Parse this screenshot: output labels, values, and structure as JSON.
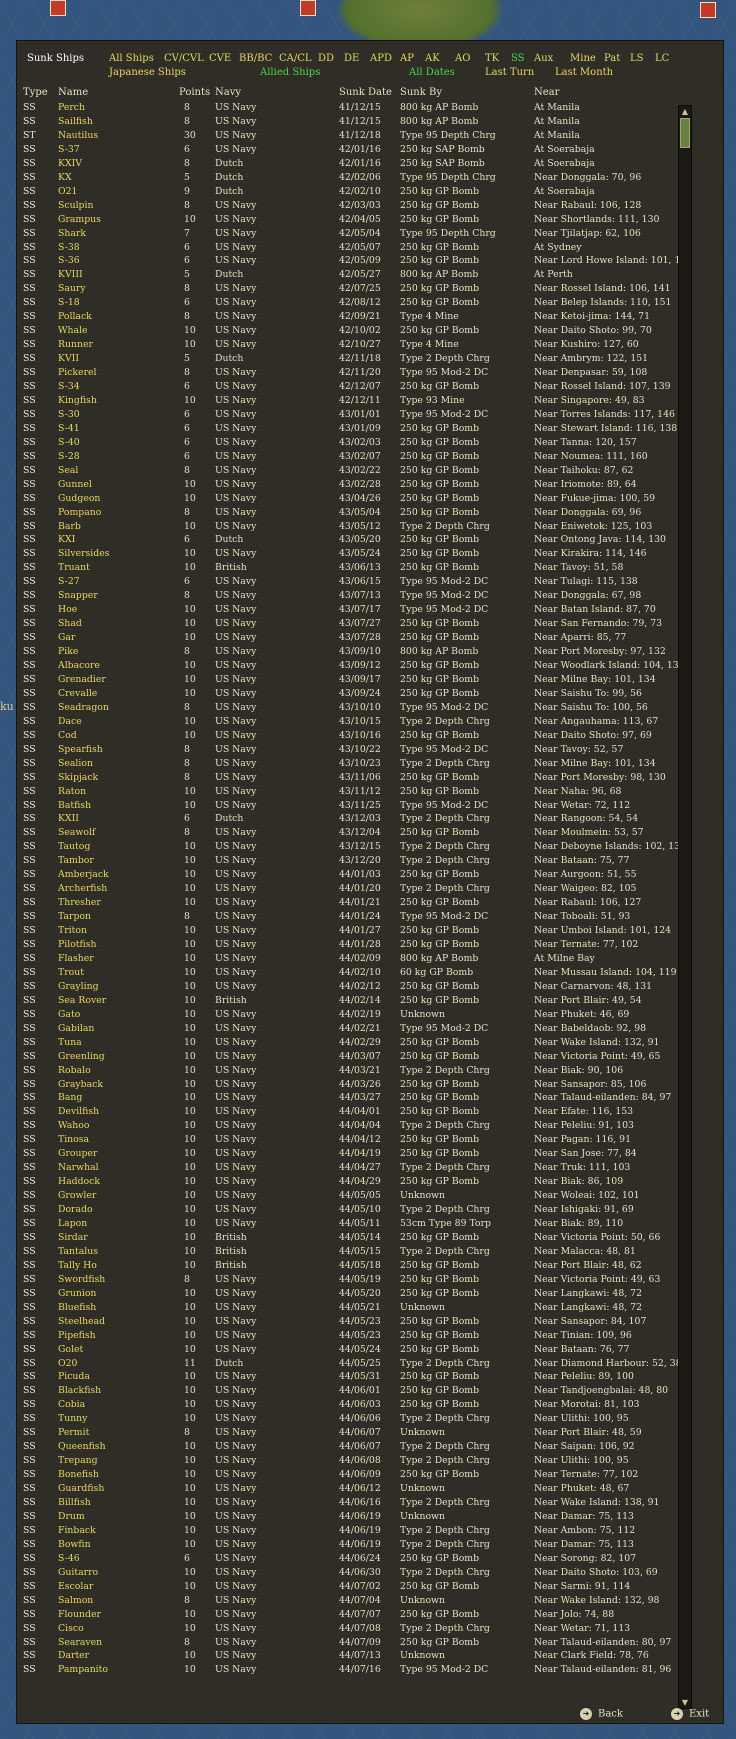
{
  "window_title": "Sunk Ships",
  "filters": {
    "all_ships": "All Ships",
    "cv_cvl": "CV/CVL",
    "cve": "CVE",
    "bb_bc": "BB/BC",
    "ca_cl": "CA/CL",
    "dd": "DD",
    "de": "DE",
    "apd": "APD",
    "ap": "AP",
    "ak": "AK",
    "ao": "AO",
    "tk": "TK",
    "ss": "SS",
    "aux": "Aux",
    "mine": "Mine",
    "pat": "Pat",
    "ls": "LS",
    "lc": "LC",
    "japanese": "Japanese Ships",
    "allied": "Allied Ships",
    "all_dates": "All Dates",
    "last_turn": "Last Turn",
    "last_month": "Last Month"
  },
  "columns": {
    "type": "Type",
    "name": "Name",
    "points": "Points",
    "navy": "Navy",
    "sunk_date": "Sunk Date",
    "sunk_by": "Sunk By",
    "near": "Near"
  },
  "rows": [
    [
      "SS",
      "Perch",
      "8",
      "US Navy",
      "41/12/15",
      "800 kg AP Bomb",
      "At Manila"
    ],
    [
      "SS",
      "Sailfish",
      "8",
      "US Navy",
      "41/12/15",
      "800 kg AP Bomb",
      "At Manila"
    ],
    [
      "ST",
      "Nautilus",
      "30",
      "US Navy",
      "41/12/18",
      "Type 95 Depth Chrg",
      "At Manila"
    ],
    [
      "SS",
      "S-37",
      "6",
      "US Navy",
      "42/01/16",
      "250 kg SAP Bomb",
      "At Soerabaja"
    ],
    [
      "SS",
      "KXIV",
      "8",
      "Dutch",
      "42/01/16",
      "250 kg SAP Bomb",
      "At Soerabaja"
    ],
    [
      "SS",
      "KX",
      "5",
      "Dutch",
      "42/02/06",
      "Type 95 Depth Chrg",
      "Near Donggala: 70, 96"
    ],
    [
      "SS",
      "O21",
      "9",
      "Dutch",
      "42/02/10",
      "250 kg GP Bomb",
      "At Soerabaja"
    ],
    [
      "SS",
      "Sculpin",
      "8",
      "US Navy",
      "42/03/03",
      "250 kg GP Bomb",
      "Near Rabaul: 106, 128"
    ],
    [
      "SS",
      "Grampus",
      "10",
      "US Navy",
      "42/04/05",
      "250 kg GP Bomb",
      "Near Shortlands: 111, 130"
    ],
    [
      "SS",
      "Shark",
      "7",
      "US Navy",
      "42/05/04",
      "Type 95 Depth Chrg",
      "Near Tjilatjap: 62, 106"
    ],
    [
      "SS",
      "S-38",
      "6",
      "US Navy",
      "42/05/07",
      "250 kg GP Bomb",
      "At Sydney"
    ],
    [
      "SS",
      "S-36",
      "6",
      "US Navy",
      "42/05/09",
      "250 kg GP Bomb",
      "Near Lord Howe Island: 101, 167"
    ],
    [
      "SS",
      "KVIII",
      "5",
      "Dutch",
      "42/05/27",
      "800 kg AP Bomb",
      "At Perth"
    ],
    [
      "SS",
      "Saury",
      "8",
      "US Navy",
      "42/07/25",
      "250 kg GP Bomb",
      "Near Rossel Island: 106, 141"
    ],
    [
      "SS",
      "S-18",
      "6",
      "US Navy",
      "42/08/12",
      "250 kg GP Bomb",
      "Near Belep Islands: 110, 151"
    ],
    [
      "SS",
      "Pollack",
      "8",
      "US Navy",
      "42/09/21",
      "Type 4 Mine",
      "Near Ketoi-jima: 144, 71"
    ],
    [
      "SS",
      "Whale",
      "10",
      "US Navy",
      "42/10/02",
      "250 kg GP Bomb",
      "Near Daito Shoto: 99, 70"
    ],
    [
      "SS",
      "Runner",
      "10",
      "US Navy",
      "42/10/27",
      "Type 4 Mine",
      "Near Kushiro: 127, 60"
    ],
    [
      "SS",
      "KVII",
      "5",
      "Dutch",
      "42/11/18",
      "Type 2 Depth Chrg",
      "Near Ambrym: 122, 151"
    ],
    [
      "SS",
      "Pickerel",
      "8",
      "US Navy",
      "42/11/20",
      "Type 95 Mod-2 DC",
      "Near Denpasar: 59, 108"
    ],
    [
      "SS",
      "S-34",
      "6",
      "US Navy",
      "42/12/07",
      "250 kg GP Bomb",
      "Near Rossel Island: 107, 139"
    ],
    [
      "SS",
      "Kingfish",
      "10",
      "US Navy",
      "42/12/11",
      "Type 93 Mine",
      "Near Singapore: 49, 83"
    ],
    [
      "SS",
      "S-30",
      "6",
      "US Navy",
      "43/01/01",
      "Type 95 Mod-2 DC",
      "Near Torres Islands: 117, 146"
    ],
    [
      "SS",
      "S-41",
      "6",
      "US Navy",
      "43/01/09",
      "250 kg GP Bomb",
      "Near Stewart Island: 116, 138"
    ],
    [
      "SS",
      "S-40",
      "6",
      "US Navy",
      "43/02/03",
      "250 kg GP Bomb",
      "Near Tanna: 120, 157"
    ],
    [
      "SS",
      "S-28",
      "6",
      "US Navy",
      "43/02/07",
      "250 kg GP Bomb",
      "Near Noumea: 111, 160"
    ],
    [
      "SS",
      "Seal",
      "8",
      "US Navy",
      "43/02/22",
      "250 kg GP Bomb",
      "Near Taihoku: 87, 62"
    ],
    [
      "SS",
      "Gunnel",
      "10",
      "US Navy",
      "43/02/28",
      "250 kg GP Bomb",
      "Near Iriomote: 89, 64"
    ],
    [
      "SS",
      "Gudgeon",
      "10",
      "US Navy",
      "43/04/26",
      "250 kg GP Bomb",
      "Near Fukue-jima: 100, 59"
    ],
    [
      "SS",
      "Pompano",
      "8",
      "US Navy",
      "43/05/04",
      "250 kg GP Bomb",
      "Near Donggala: 69, 96"
    ],
    [
      "SS",
      "Barb",
      "10",
      "US Navy",
      "43/05/12",
      "Type 2 Depth Chrg",
      "Near Eniwetok: 125, 103"
    ],
    [
      "SS",
      "KXI",
      "6",
      "Dutch",
      "43/05/20",
      "250 kg GP Bomb",
      "Near Ontong Java: 114, 130"
    ],
    [
      "SS",
      "Silversides",
      "10",
      "US Navy",
      "43/05/24",
      "250 kg GP Bomb",
      "Near Kirakira: 114, 146"
    ],
    [
      "SS",
      "Truant",
      "10",
      "British",
      "43/06/13",
      "250 kg GP Bomb",
      "Near Tavoy: 51, 58"
    ],
    [
      "SS",
      "S-27",
      "6",
      "US Navy",
      "43/06/15",
      "Type 95 Mod-2 DC",
      "Near Tulagi: 115, 138"
    ],
    [
      "SS",
      "Snapper",
      "8",
      "US Navy",
      "43/07/13",
      "Type 95 Mod-2 DC",
      "Near Donggala: 67, 98"
    ],
    [
      "SS",
      "Hoe",
      "10",
      "US Navy",
      "43/07/17",
      "Type 95 Mod-2 DC",
      "Near Batan Island: 87, 70"
    ],
    [
      "SS",
      "Shad",
      "10",
      "US Navy",
      "43/07/27",
      "250 kg GP Bomb",
      "Near San Fernando: 79, 73"
    ],
    [
      "SS",
      "Gar",
      "10",
      "US Navy",
      "43/07/28",
      "250 kg GP Bomb",
      "Near Aparri: 85, 77"
    ],
    [
      "SS",
      "Pike",
      "8",
      "US Navy",
      "43/09/10",
      "800 kg AP Bomb",
      "Near Port Moresby: 97, 132"
    ],
    [
      "SS",
      "Albacore",
      "10",
      "US Navy",
      "43/09/12",
      "250 kg GP Bomb",
      "Near Woodlark Island: 104, 133"
    ],
    [
      "SS",
      "Grenadier",
      "10",
      "US Navy",
      "43/09/17",
      "250 kg GP Bomb",
      "Near Milne Bay: 101, 134"
    ],
    [
      "SS",
      "Crevalle",
      "10",
      "US Navy",
      "43/09/24",
      "250 kg GP Bomb",
      "Near Saishu To: 99, 56"
    ],
    [
      "SS",
      "Seadragon",
      "8",
      "US Navy",
      "43/10/10",
      "Type 95 Mod-2 DC",
      "Near Saishu To: 100, 56"
    ],
    [
      "SS",
      "Dace",
      "10",
      "US Navy",
      "43/10/15",
      "Type 2 Depth Chrg",
      "Near Angauhama: 113, 67"
    ],
    [
      "SS",
      "Cod",
      "10",
      "US Navy",
      "43/10/16",
      "250 kg GP Bomb",
      "Near Daito Shoto: 97, 69"
    ],
    [
      "SS",
      "Spearfish",
      "8",
      "US Navy",
      "43/10/22",
      "Type 95 Mod-2 DC",
      "Near Tavoy: 52, 57"
    ],
    [
      "SS",
      "Sealion",
      "8",
      "US Navy",
      "43/10/23",
      "Type 2 Depth Chrg",
      "Near Milne Bay: 101, 134"
    ],
    [
      "SS",
      "Skipjack",
      "8",
      "US Navy",
      "43/11/06",
      "250 kg GP Bomb",
      "Near Port Moresby: 98, 130"
    ],
    [
      "SS",
      "Raton",
      "10",
      "US Navy",
      "43/11/12",
      "250 kg GP Bomb",
      "Near Naha: 96, 68"
    ],
    [
      "SS",
      "Batfish",
      "10",
      "US Navy",
      "43/11/25",
      "Type 95 Mod-2 DC",
      "Near Wetar: 72, 112"
    ],
    [
      "SS",
      "KXII",
      "6",
      "Dutch",
      "43/12/03",
      "Type 2 Depth Chrg",
      "Near Rangoon: 54, 54"
    ],
    [
      "SS",
      "Seawolf",
      "8",
      "US Navy",
      "43/12/04",
      "250 kg GP Bomb",
      "Near Moulmein: 53, 57"
    ],
    [
      "SS",
      "Tautog",
      "10",
      "US Navy",
      "43/12/15",
      "Type 2 Depth Chrg",
      "Near Deboyne Islands: 102, 135"
    ],
    [
      "SS",
      "Tambor",
      "10",
      "US Navy",
      "43/12/20",
      "Type 2 Depth Chrg",
      "Near Bataan: 75, 77"
    ],
    [
      "SS",
      "Amberjack",
      "10",
      "US Navy",
      "44/01/03",
      "250 kg GP Bomb",
      "Near Aurgoon: 51, 55"
    ],
    [
      "SS",
      "Archerfish",
      "10",
      "US Navy",
      "44/01/20",
      "Type 2 Depth Chrg",
      "Near Waigeo: 82, 105"
    ],
    [
      "SS",
      "Thresher",
      "10",
      "US Navy",
      "44/01/21",
      "250 kg GP Bomb",
      "Near Rabaul: 106, 127"
    ],
    [
      "SS",
      "Tarpon",
      "8",
      "US Navy",
      "44/01/24",
      "Type 95 Mod-2 DC",
      "Near Toboali: 51, 93"
    ],
    [
      "SS",
      "Triton",
      "10",
      "US Navy",
      "44/01/27",
      "250 kg GP Bomb",
      "Near Umboi Island: 101, 124"
    ],
    [
      "SS",
      "Pilotfish",
      "10",
      "US Navy",
      "44/01/28",
      "250 kg GP Bomb",
      "Near Ternate: 77, 102"
    ],
    [
      "SS",
      "Flasher",
      "10",
      "US Navy",
      "44/02/09",
      "800 kg AP Bomb",
      "At Milne Bay"
    ],
    [
      "SS",
      "Trout",
      "10",
      "US Navy",
      "44/02/10",
      "60 kg GP Bomb",
      "Near Mussau Island: 104, 119"
    ],
    [
      "SS",
      "Grayling",
      "10",
      "US Navy",
      "44/02/12",
      "250 kg GP Bomb",
      "Near Carnarvon: 48, 131"
    ],
    [
      "SS",
      "Sea Rover",
      "10",
      "British",
      "44/02/14",
      "250 kg GP Bomb",
      "Near Port Blair: 49, 54"
    ],
    [
      "SS",
      "Gato",
      "10",
      "US Navy",
      "44/02/19",
      "Unknown",
      "Near Phuket: 46, 69"
    ],
    [
      "SS",
      "Gabilan",
      "10",
      "US Navy",
      "44/02/21",
      "Type 95 Mod-2 DC",
      "Near Babeldaob: 92, 98"
    ],
    [
      "SS",
      "Tuna",
      "10",
      "US Navy",
      "44/02/29",
      "250 kg GP Bomb",
      "Near Wake Island: 132, 91"
    ],
    [
      "SS",
      "Greenling",
      "10",
      "US Navy",
      "44/03/07",
      "250 kg GP Bomb",
      "Near Victoria Point: 49, 65"
    ],
    [
      "SS",
      "Robalo",
      "10",
      "US Navy",
      "44/03/21",
      "Type 2 Depth Chrg",
      "Near Biak: 90, 106"
    ],
    [
      "SS",
      "Grayback",
      "10",
      "US Navy",
      "44/03/26",
      "250 kg GP Bomb",
      "Near Sansapor: 85, 106"
    ],
    [
      "SS",
      "Bang",
      "10",
      "US Navy",
      "44/03/27",
      "250 kg GP Bomb",
      "Near Talaud-eilanden: 84, 97"
    ],
    [
      "SS",
      "Devilfish",
      "10",
      "US Navy",
      "44/04/01",
      "250 kg GP Bomb",
      "Near Efate: 116, 153"
    ],
    [
      "SS",
      "Wahoo",
      "10",
      "US Navy",
      "44/04/04",
      "Type 2 Depth Chrg",
      "Near Peleliu: 91, 103"
    ],
    [
      "SS",
      "Tinosa",
      "10",
      "US Navy",
      "44/04/12",
      "250 kg GP Bomb",
      "Near Pagan: 116, 91"
    ],
    [
      "SS",
      "Grouper",
      "10",
      "US Navy",
      "44/04/19",
      "250 kg GP Bomb",
      "Near San Jose: 77, 84"
    ],
    [
      "SS",
      "Narwhal",
      "10",
      "US Navy",
      "44/04/27",
      "Type 2 Depth Chrg",
      "Near Truk: 111, 103"
    ],
    [
      "SS",
      "Haddock",
      "10",
      "US Navy",
      "44/04/29",
      "250 kg GP Bomb",
      "Near Biak: 86, 109"
    ],
    [
      "SS",
      "Growler",
      "10",
      "US Navy",
      "44/05/05",
      "Unknown",
      "Near Woleai: 102, 101"
    ],
    [
      "SS",
      "Dorado",
      "10",
      "US Navy",
      "44/05/10",
      "Type 2 Depth Chrg",
      "Near Ishigaki: 91, 69"
    ],
    [
      "SS",
      "Lapon",
      "10",
      "US Navy",
      "44/05/11",
      "53cm Type 89 Torp",
      "Near Biak: 89, 110"
    ],
    [
      "SS",
      "Sirdar",
      "10",
      "British",
      "44/05/14",
      "250 kg GP Bomb",
      "Near Victoria Point: 50, 66"
    ],
    [
      "SS",
      "Tantalus",
      "10",
      "British",
      "44/05/15",
      "Type 2 Depth Chrg",
      "Near Malacca: 48, 81"
    ],
    [
      "SS",
      "Tally Ho",
      "10",
      "British",
      "44/05/18",
      "250 kg GP Bomb",
      "Near Port Blair: 48, 62"
    ],
    [
      "SS",
      "Swordfish",
      "8",
      "US Navy",
      "44/05/19",
      "250 kg GP Bomb",
      "Near Victoria Point: 49, 63"
    ],
    [
      "SS",
      "Grunion",
      "10",
      "US Navy",
      "44/05/20",
      "250 kg GP Bomb",
      "Near Langkawi: 48, 72"
    ],
    [
      "SS",
      "Bluefish",
      "10",
      "US Navy",
      "44/05/21",
      "Unknown",
      "Near Langkawi: 48, 72"
    ],
    [
      "SS",
      "Steelhead",
      "10",
      "US Navy",
      "44/05/23",
      "250 kg GP Bomb",
      "Near Sansapor: 84, 107"
    ],
    [
      "SS",
      "Pipefish",
      "10",
      "US Navy",
      "44/05/23",
      "250 kg GP Bomb",
      "Near Tinian: 109, 96"
    ],
    [
      "SS",
      "Golet",
      "10",
      "US Navy",
      "44/05/24",
      "250 kg GP Bomb",
      "Near Bataan: 76, 77"
    ],
    [
      "SS",
      "O20",
      "11",
      "Dutch",
      "44/05/25",
      "Type 2 Depth Chrg",
      "Near Diamond Harbour: 52, 38"
    ],
    [
      "SS",
      "Picuda",
      "10",
      "US Navy",
      "44/05/31",
      "250 kg GP Bomb",
      "Near Peleliu: 89, 100"
    ],
    [
      "SS",
      "Blackfish",
      "10",
      "US Navy",
      "44/06/01",
      "250 kg GP Bomb",
      "Near Tandjoengbalai: 48, 80"
    ],
    [
      "SS",
      "Cobia",
      "10",
      "US Navy",
      "44/06/03",
      "250 kg GP Bomb",
      "Near Morotai: 81, 103"
    ],
    [
      "SS",
      "Tunny",
      "10",
      "US Navy",
      "44/06/06",
      "Type 2 Depth Chrg",
      "Near Ulithi: 100, 95"
    ],
    [
      "SS",
      "Permit",
      "8",
      "US Navy",
      "44/06/07",
      "Unknown",
      "Near Port Blair: 48, 59"
    ],
    [
      "SS",
      "Queenfish",
      "10",
      "US Navy",
      "44/06/07",
      "Type 2 Depth Chrg",
      "Near Saipan: 106, 92"
    ],
    [
      "SS",
      "Trepang",
      "10",
      "US Navy",
      "44/06/08",
      "Type 2 Depth Chrg",
      "Near Ulithi: 100, 95"
    ],
    [
      "SS",
      "Bonefish",
      "10",
      "US Navy",
      "44/06/09",
      "250 kg GP Bomb",
      "Near Ternate: 77, 102"
    ],
    [
      "SS",
      "Guardfish",
      "10",
      "US Navy",
      "44/06/12",
      "Unknown",
      "Near Phuket: 48, 67"
    ],
    [
      "SS",
      "Billfish",
      "10",
      "US Navy",
      "44/06/16",
      "Type 2 Depth Chrg",
      "Near Wake Island: 138, 91"
    ],
    [
      "SS",
      "Drum",
      "10",
      "US Navy",
      "44/06/19",
      "Unknown",
      "Near Damar: 75, 113"
    ],
    [
      "SS",
      "Finback",
      "10",
      "US Navy",
      "44/06/19",
      "Type 2 Depth Chrg",
      "Near Ambon: 75, 112"
    ],
    [
      "SS",
      "Bowfin",
      "10",
      "US Navy",
      "44/06/19",
      "Type 2 Depth Chrg",
      "Near Damar: 75, 113"
    ],
    [
      "SS",
      "S-46",
      "6",
      "US Navy",
      "44/06/24",
      "250 kg GP Bomb",
      "Near Sorong: 82, 107"
    ],
    [
      "SS",
      "Guitarro",
      "10",
      "US Navy",
      "44/06/30",
      "Type 2 Depth Chrg",
      "Near Daito Shoto: 103, 69"
    ],
    [
      "SS",
      "Escolar",
      "10",
      "US Navy",
      "44/07/02",
      "250 kg GP Bomb",
      "Near Sarmi: 91, 114"
    ],
    [
      "SS",
      "Salmon",
      "8",
      "US Navy",
      "44/07/04",
      "Unknown",
      "Near Wake Island: 132, 98"
    ],
    [
      "SS",
      "Flounder",
      "10",
      "US Navy",
      "44/07/07",
      "250 kg GP Bomb",
      "Near Jolo: 74, 88"
    ],
    [
      "SS",
      "Cisco",
      "10",
      "US Navy",
      "44/07/08",
      "Type 2 Depth Chrg",
      "Near Wetar: 71, 113"
    ],
    [
      "SS",
      "Searaven",
      "8",
      "US Navy",
      "44/07/09",
      "250 kg GP Bomb",
      "Near Talaud-eilanden: 80, 97"
    ],
    [
      "SS",
      "Darter",
      "10",
      "US Navy",
      "44/07/13",
      "Unknown",
      "Near Clark Field: 78, 76"
    ],
    [
      "SS",
      "Pampanito",
      "10",
      "US Navy",
      "44/07/16",
      "Type 95 Mod-2 DC",
      "Near Talaud-eilanden: 81, 96"
    ]
  ],
  "bottom": {
    "back": "Back",
    "exit": "Exit"
  },
  "map_labels": {
    "left_label": "ku"
  },
  "icons": {
    "back": "arrow-right-icon",
    "exit": "arrow-right-icon",
    "scroll_up": "triangle-up-icon",
    "scroll_down": "triangle-down-icon"
  }
}
